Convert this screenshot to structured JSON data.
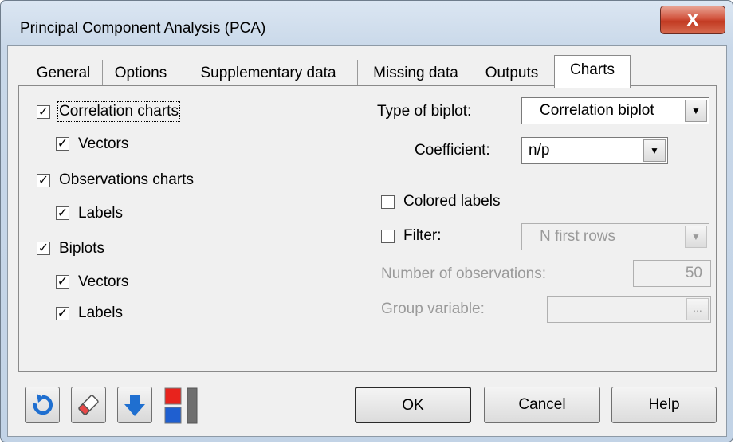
{
  "window": {
    "title": "Principal Component Analysis (PCA)",
    "close_label": "X"
  },
  "tabs": [
    {
      "label": "General"
    },
    {
      "label": "Options"
    },
    {
      "label": "Supplementary data"
    },
    {
      "label": "Missing data"
    },
    {
      "label": "Outputs"
    },
    {
      "label": "Charts"
    }
  ],
  "active_tab": "Charts",
  "left": {
    "correlation_charts": {
      "label": "Correlation charts",
      "checked": true
    },
    "corr_vectors": {
      "label": "Vectors",
      "checked": true
    },
    "observations_charts": {
      "label": "Observations charts",
      "checked": true
    },
    "obs_labels": {
      "label": "Labels",
      "checked": true
    },
    "biplots": {
      "label": "Biplots",
      "checked": true
    },
    "bi_vectors": {
      "label": "Vectors",
      "checked": true
    },
    "bi_labels": {
      "label": "Labels",
      "checked": true
    }
  },
  "right": {
    "type_of_biplot": {
      "label": "Type of biplot:",
      "value": "Correlation biplot"
    },
    "coefficient": {
      "label": "Coefficient:",
      "value": "n/p"
    },
    "colored_labels": {
      "label": "Colored labels",
      "checked": false
    },
    "filter": {
      "label": "Filter:",
      "checked": false,
      "value": "N first rows"
    },
    "num_observations": {
      "label": "Number of observations:",
      "value": "50"
    },
    "group_variable": {
      "label": "Group variable:",
      "value": "",
      "button": "..."
    }
  },
  "footer": {
    "ok": "OK",
    "cancel": "Cancel",
    "help": "Help"
  },
  "colors": {
    "close_button": "#c23a22",
    "reset_icon": "#1f6fd0",
    "down_icon": "#1f6fd0",
    "swatch_red": "#e8231d",
    "swatch_blue": "#1f5fd0"
  },
  "icons": [
    "reset-icon",
    "eraser-icon",
    "download-icon",
    "toggle-panel-icon"
  ]
}
